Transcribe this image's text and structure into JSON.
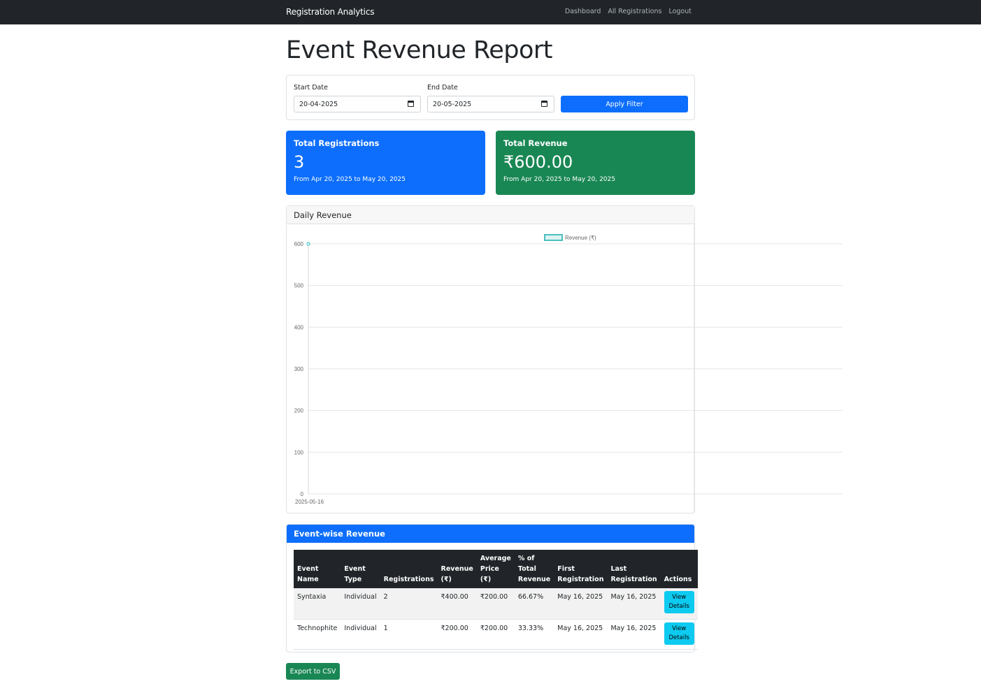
{
  "navbar": {
    "brand": "Registration Analytics",
    "links": [
      "Dashboard",
      "All Registrations",
      "Logout"
    ]
  },
  "page_title": "Event Revenue Report",
  "filter": {
    "start_label": "Start Date",
    "start_value": "20-04-2025",
    "end_label": "End Date",
    "end_value": "20-05-2025",
    "apply_label": "Apply Filter"
  },
  "stats": {
    "registrations": {
      "title": "Total Registrations",
      "value": "3",
      "range": "From Apr 20, 2025 to May 20, 2025",
      "color": "#0d6efd"
    },
    "revenue": {
      "title": "Total Revenue",
      "value": "₹600.00",
      "range": "From Apr 20, 2025 to May 20, 2025",
      "color": "#198754"
    }
  },
  "chart_card_title": "Daily Revenue",
  "chart_data": {
    "type": "line",
    "x": [
      "2025-05-16"
    ],
    "series": [
      {
        "name": "Revenue (₹)",
        "values": [
          600
        ],
        "color": "#4bc0c0"
      }
    ],
    "yticks": [
      0,
      100,
      200,
      300,
      400,
      500,
      600
    ],
    "ylim": [
      0,
      600
    ],
    "grid": true,
    "legend": "top"
  },
  "event_table": {
    "title": "Event-wise Revenue",
    "headers": [
      [
        "Event",
        "Name"
      ],
      [
        "Event",
        "Type"
      ],
      [
        "Registrations"
      ],
      [
        "Revenue",
        "(₹)"
      ],
      [
        "Average",
        "Price (₹)"
      ],
      [
        "% of Total",
        "Revenue"
      ],
      [
        "First",
        "Registration"
      ],
      [
        "Last",
        "Registration"
      ],
      [
        "Actions"
      ]
    ],
    "rows": [
      [
        "Syntaxia",
        "Individual",
        "2",
        "₹400.00",
        "₹200.00",
        "66.67%",
        "May 16, 2025",
        "May 16, 2025"
      ],
      [
        "Technophite",
        "Individual",
        "1",
        "₹200.00",
        "₹200.00",
        "33.33%",
        "May 16, 2025",
        "May 16, 2025"
      ]
    ],
    "action_label": "View Details"
  },
  "export_label": "Export to CSV"
}
